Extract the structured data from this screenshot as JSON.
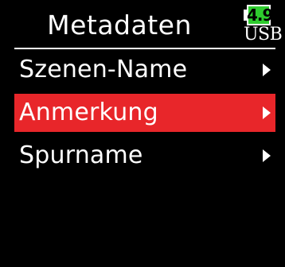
{
  "header": {
    "title": "Metadaten"
  },
  "battery": {
    "voltage": "4.9",
    "source": "USB",
    "color": "#2ecc2e"
  },
  "menu": {
    "items": [
      {
        "label": "Szenen-Name",
        "selected": false,
        "icon": "chevron-right-icon"
      },
      {
        "label": "Anmerkung",
        "selected": true,
        "icon": "chevron-right-icon"
      },
      {
        "label": "Spurname",
        "selected": false,
        "icon": "chevron-right-icon"
      }
    ],
    "selected_color": "#e8262a"
  }
}
